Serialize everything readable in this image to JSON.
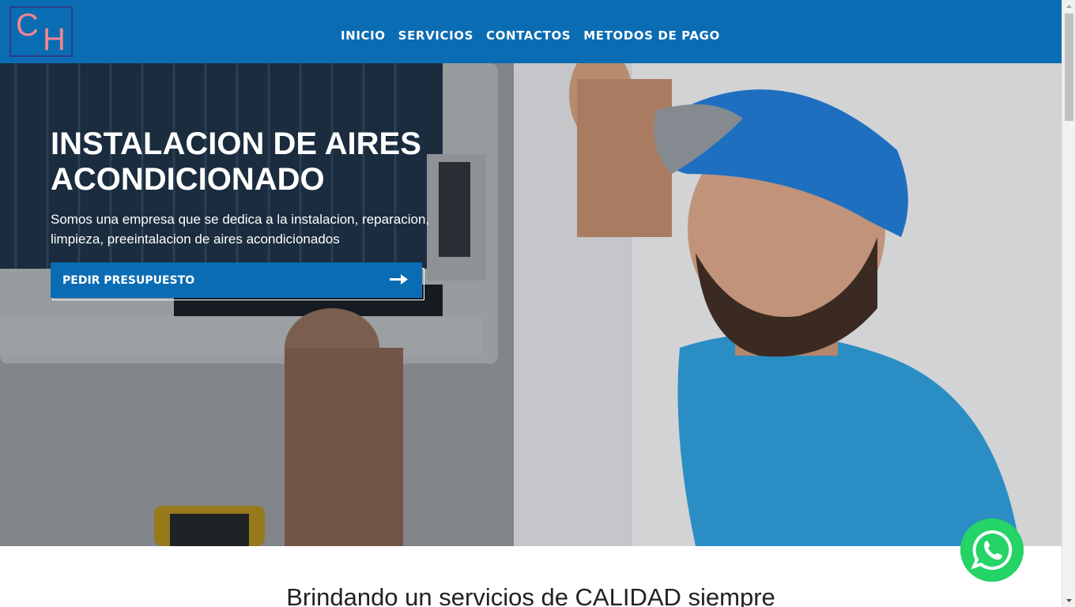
{
  "brand": {
    "logo_letter_1": "C",
    "logo_letter_2": "H"
  },
  "nav": {
    "items": [
      {
        "label": "INICIO"
      },
      {
        "label": "SERVICIOS"
      },
      {
        "label": "CONTACTOS"
      },
      {
        "label": "METODOS DE PAGO"
      }
    ]
  },
  "hero": {
    "title": "INSTALACION DE AIRES ACONDICIONADO",
    "description": "Somos una empresa que se dedica a la instalacion, reparacion, limpieza, preeintalacion de aires acondicionados",
    "cta_label": "PEDIR PRESUPUESTO",
    "cta_icon": "arrow-right-icon"
  },
  "section": {
    "tagline": "Brindando un servicios de CALIDAD siempre"
  },
  "floating": {
    "icon": "whatsapp-icon"
  },
  "colors": {
    "primary": "#0a6cb3",
    "logo_text": "#f1868f",
    "whatsapp": "#25d366",
    "white": "#ffffff"
  }
}
